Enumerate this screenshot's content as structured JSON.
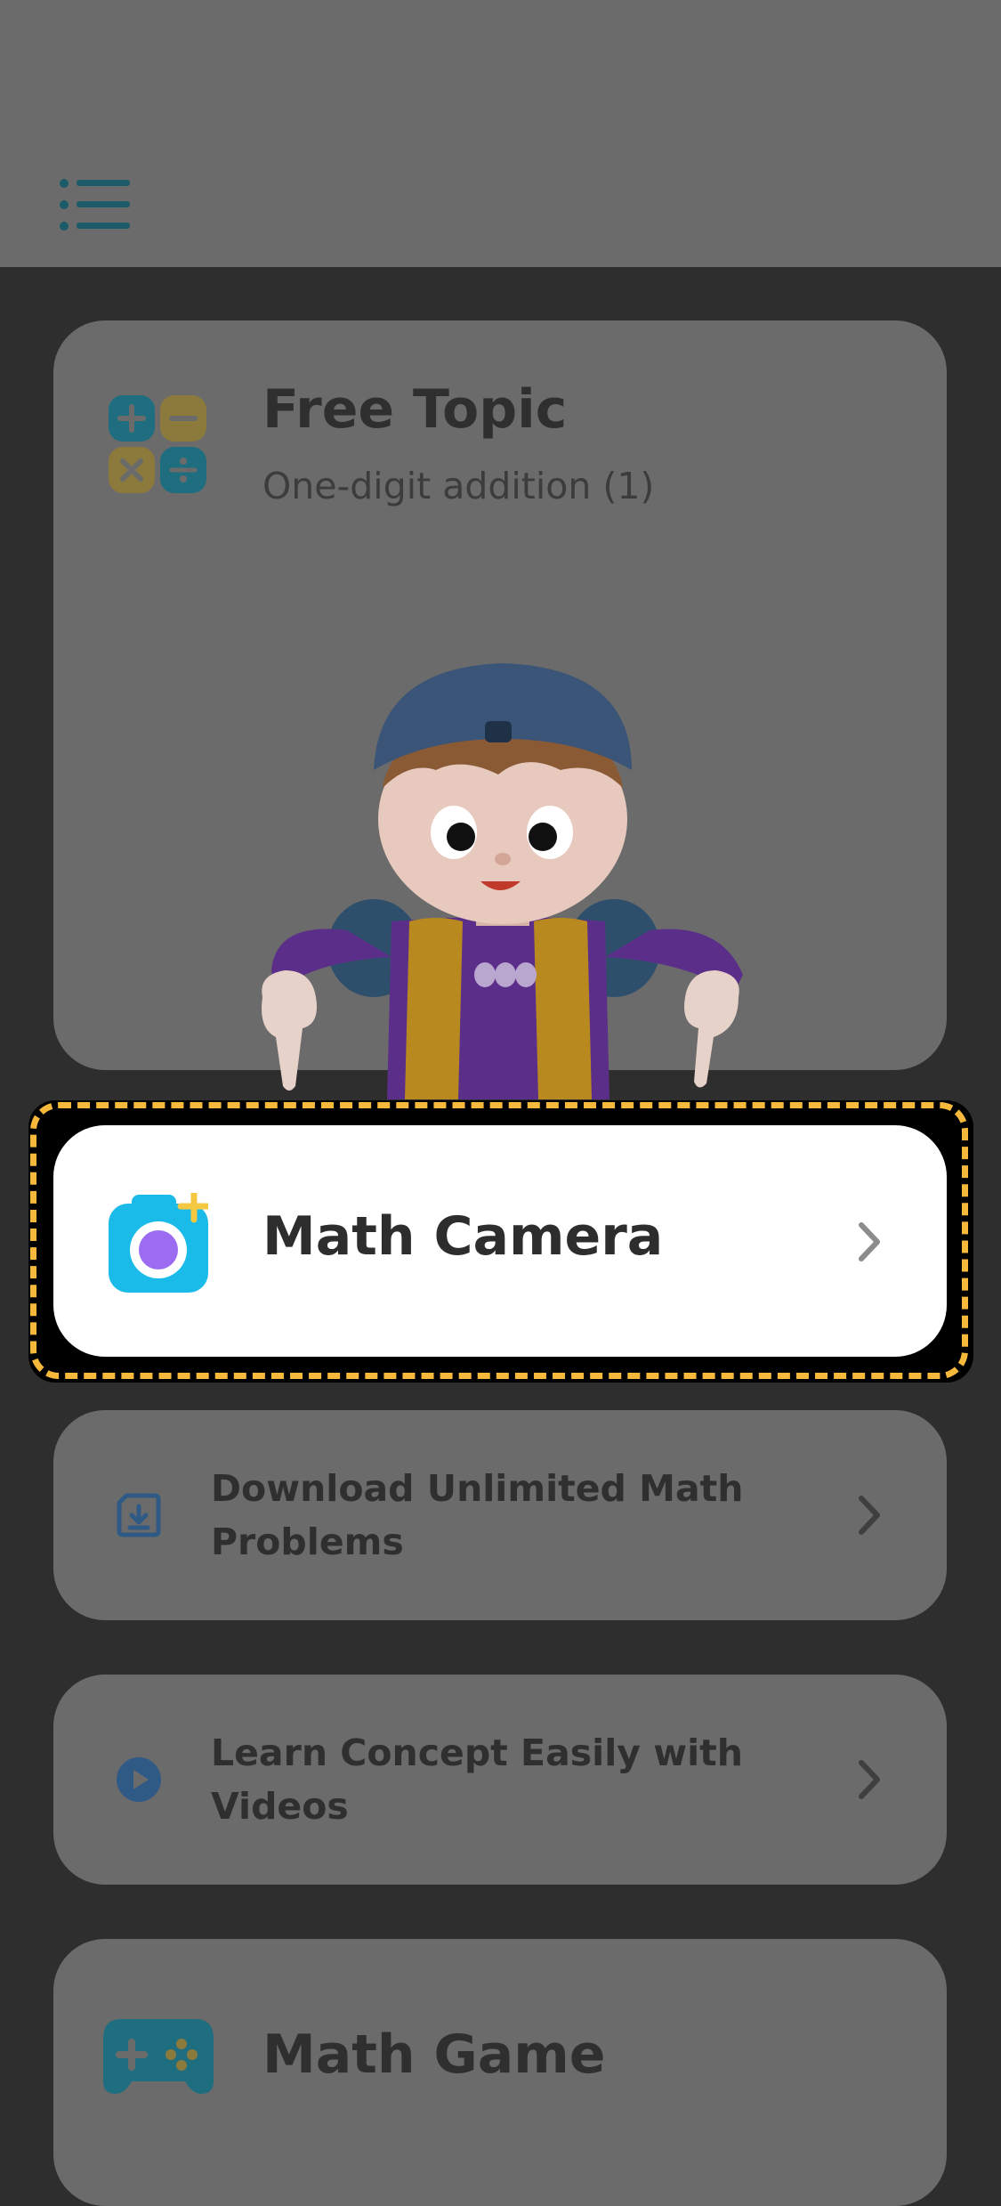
{
  "header": {
    "menu_icon": "list-menu-icon"
  },
  "free_topic": {
    "title": "Free Topic",
    "subtitle": "One-digit addition (1)",
    "icon": "math-operations-icon"
  },
  "math_camera": {
    "label": "Math Camera",
    "icon": "camera-icon",
    "chevron": "chevron-right-icon"
  },
  "menu_rows": [
    {
      "label": "Download Unlimited Math Problems",
      "icon": "download-icon"
    },
    {
      "label": "Learn Concept Easily with Videos",
      "icon": "play-icon"
    }
  ],
  "math_game": {
    "title": "Math Game",
    "icon": "gamepad-icon"
  },
  "colors": {
    "overlay_gray": "#6b6b6b",
    "background": "#2e2e2e",
    "highlight_dash": "#f6b93b",
    "camera_blue": "#1bbbe9",
    "camera_purple": "#9b6cf2"
  }
}
